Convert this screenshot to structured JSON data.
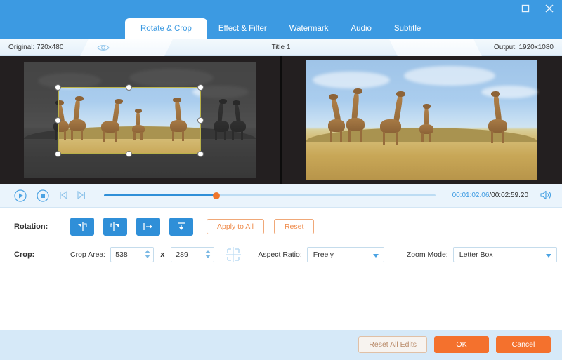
{
  "window": {
    "maximize_icon": "maximize-icon",
    "close_icon": "close-icon",
    "accent_blue": "#3c9ae2",
    "accent_orange": "#f4712d"
  },
  "tabs": [
    {
      "label": "Rotate & Crop",
      "active": true
    },
    {
      "label": "Effect & Filter",
      "active": false
    },
    {
      "label": "Watermark",
      "active": false
    },
    {
      "label": "Audio",
      "active": false
    },
    {
      "label": "Subtitle",
      "active": false
    }
  ],
  "infobar": {
    "original": "Original: 720x480",
    "eye_icon": "eye-icon",
    "title": "Title 1",
    "output": "Output: 1920x1080"
  },
  "player": {
    "play_icon": "play-icon",
    "stop_icon": "stop-icon",
    "previous_icon": "previous-frame-icon",
    "next_icon": "next-frame-icon",
    "speaker_icon": "volume-icon",
    "current_time": "00:01:02.06",
    "total_time": "00:02:59.20",
    "separator": "/",
    "progress_percent": 34
  },
  "rotation": {
    "label": "Rotation:",
    "buttons": [
      {
        "name": "rotate-left-button",
        "icon": "rotate-left-icon"
      },
      {
        "name": "rotate-right-button",
        "icon": "rotate-right-icon"
      },
      {
        "name": "flip-horizontal-button",
        "icon": "flip-horizontal-icon"
      },
      {
        "name": "flip-vertical-button",
        "icon": "flip-vertical-icon"
      }
    ],
    "apply_to_all": "Apply to All",
    "reset": "Reset"
  },
  "crop": {
    "label": "Crop:",
    "area_label": "Crop Area:",
    "width": "538",
    "height": "289",
    "multiply": "x",
    "position_icon": "crop-position-icon",
    "aspect_ratio_label": "Aspect Ratio:",
    "aspect_ratio_value": "Freely",
    "zoom_mode_label": "Zoom Mode:",
    "zoom_mode_value": "Letter Box"
  },
  "footer": {
    "reset_all_edits": "Reset All Edits",
    "ok": "OK",
    "cancel": "Cancel"
  }
}
